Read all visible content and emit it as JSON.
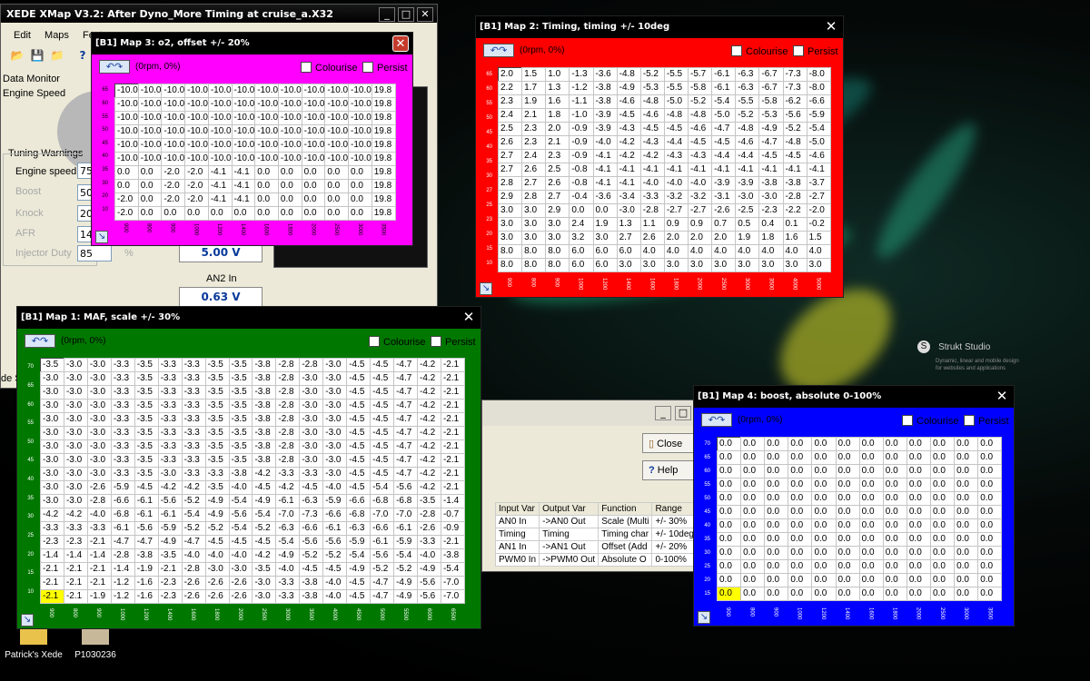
{
  "main_window": {
    "title": "XEDE XMap V3.2: After Dyno_More Timing at cruise_a.X32",
    "menu": [
      "Edit",
      "Maps",
      "Feat"
    ],
    "data_monitor": "Data Monitor",
    "engine_speed": "Engine Speed",
    "tuning_warnings": "Tuning Warnings",
    "warnings": [
      {
        "label": "Engine speed",
        "value": "750"
      },
      {
        "label": "Boost",
        "value": "50"
      },
      {
        "label": "Knock",
        "value": "20"
      },
      {
        "label": "AFR",
        "value": "14"
      },
      {
        "label": "Injector Duty",
        "value": "85",
        "unit": "%"
      }
    ],
    "volt1": "5.00 V",
    "an2_label": "AN2 In",
    "volt2": "0.63 V",
    "side_text": "de S"
  },
  "map3": {
    "title": "[B1] Map 3: o2, offset +/- 20%",
    "color": "#ff00ff",
    "rpm_label": "(0rpm, 0%)",
    "colourise": "Colourise",
    "persist": "Persist",
    "y_axis": [
      "65",
      "60",
      "55",
      "50",
      "45",
      "40",
      "35",
      "30",
      "20",
      "10"
    ],
    "x_axis": [
      "900",
      "800",
      "900",
      "1000",
      "1200",
      "1400",
      "1600",
      "1800",
      "2000",
      "2500",
      "3000",
      "3500"
    ],
    "rows": [
      [
        "-10.0",
        "-10.0",
        "-10.0",
        "-10.0",
        "-10.0",
        "-10.0",
        "-10.0",
        "-10.0",
        "-10.0",
        "-10.0",
        "-10.0",
        "19.8"
      ],
      [
        "-10.0",
        "-10.0",
        "-10.0",
        "-10.0",
        "-10.0",
        "-10.0",
        "-10.0",
        "-10.0",
        "-10.0",
        "-10.0",
        "-10.0",
        "19.8"
      ],
      [
        "-10.0",
        "-10.0",
        "-10.0",
        "-10.0",
        "-10.0",
        "-10.0",
        "-10.0",
        "-10.0",
        "-10.0",
        "-10.0",
        "-10.0",
        "19.8"
      ],
      [
        "-10.0",
        "-10.0",
        "-10.0",
        "-10.0",
        "-10.0",
        "-10.0",
        "-10.0",
        "-10.0",
        "-10.0",
        "-10.0",
        "-10.0",
        "19.8"
      ],
      [
        "-10.0",
        "-10.0",
        "-10.0",
        "-10.0",
        "-10.0",
        "-10.0",
        "-10.0",
        "-10.0",
        "-10.0",
        "-10.0",
        "-10.0",
        "19.8"
      ],
      [
        "-10.0",
        "-10.0",
        "-10.0",
        "-10.0",
        "-10.0",
        "-10.0",
        "-10.0",
        "-10.0",
        "-10.0",
        "-10.0",
        "-10.0",
        "19.8"
      ],
      [
        "0.0",
        "0.0",
        "-2.0",
        "-2.0",
        "-4.1",
        "-4.1",
        "0.0",
        "0.0",
        "0.0",
        "0.0",
        "0.0",
        "19.8"
      ],
      [
        "0.0",
        "0.0",
        "-2.0",
        "-2.0",
        "-4.1",
        "-4.1",
        "0.0",
        "0.0",
        "0.0",
        "0.0",
        "0.0",
        "19.8"
      ],
      [
        "-2.0",
        "0.0",
        "-2.0",
        "-2.0",
        "-4.1",
        "-4.1",
        "0.0",
        "0.0",
        "0.0",
        "0.0",
        "0.0",
        "19.8"
      ],
      [
        "-2.0",
        "0.0",
        "0.0",
        "0.0",
        "0.0",
        "0.0",
        "0.0",
        "0.0",
        "0.0",
        "0.0",
        "0.0",
        "19.8"
      ]
    ]
  },
  "map2": {
    "title": "[B1] Map 2: Timing, timing +/- 10deg",
    "color": "#ff0000",
    "rpm_label": "(0rpm, 0%)",
    "colourise": "Colourise",
    "persist": "Persist",
    "y_axis": [
      "65",
      "60",
      "55",
      "50",
      "45",
      "40",
      "35",
      "30",
      "27",
      "25",
      "23",
      "20",
      "15",
      "10"
    ],
    "x_axis": [
      "900",
      "800",
      "900",
      "1000",
      "1200",
      "1400",
      "1600",
      "1800",
      "2000",
      "2500",
      "3000",
      "3500",
      "4000",
      "5000"
    ],
    "rows": [
      [
        "2.0",
        "1.5",
        "1.0",
        "-1.3",
        "-3.6",
        "-4.8",
        "-5.2",
        "-5.5",
        "-5.7",
        "-6.1",
        "-6.3",
        "-6.7",
        "-7.3",
        "-8.0"
      ],
      [
        "2.2",
        "1.7",
        "1.3",
        "-1.2",
        "-3.8",
        "-4.9",
        "-5.3",
        "-5.5",
        "-5.8",
        "-6.1",
        "-6.3",
        "-6.7",
        "-7.3",
        "-8.0"
      ],
      [
        "2.3",
        "1.9",
        "1.6",
        "-1.1",
        "-3.8",
        "-4.6",
        "-4.8",
        "-5.0",
        "-5.2",
        "-5.4",
        "-5.5",
        "-5.8",
        "-6.2",
        "-6.6"
      ],
      [
        "2.4",
        "2.1",
        "1.8",
        "-1.0",
        "-3.9",
        "-4.5",
        "-4.6",
        "-4.8",
        "-4.8",
        "-5.0",
        "-5.2",
        "-5.3",
        "-5.6",
        "-5.9"
      ],
      [
        "2.5",
        "2.3",
        "2.0",
        "-0.9",
        "-3.9",
        "-4.3",
        "-4.5",
        "-4.5",
        "-4.6",
        "-4.7",
        "-4.8",
        "-4.9",
        "-5.2",
        "-5.4"
      ],
      [
        "2.6",
        "2.3",
        "2.1",
        "-0.9",
        "-4.0",
        "-4.2",
        "-4.3",
        "-4.4",
        "-4.5",
        "-4.5",
        "-4.6",
        "-4.7",
        "-4.8",
        "-5.0"
      ],
      [
        "2.7",
        "2.4",
        "2.3",
        "-0.9",
        "-4.1",
        "-4.2",
        "-4.2",
        "-4.3",
        "-4.3",
        "-4.4",
        "-4.4",
        "-4.5",
        "-4.5",
        "-4.6"
      ],
      [
        "2.7",
        "2.6",
        "2.5",
        "-0.8",
        "-4.1",
        "-4.1",
        "-4.1",
        "-4.1",
        "-4.1",
        "-4.1",
        "-4.1",
        "-4.1",
        "-4.1",
        "-4.1"
      ],
      [
        "2.8",
        "2.7",
        "2.6",
        "-0.8",
        "-4.1",
        "-4.1",
        "-4.0",
        "-4.0",
        "-4.0",
        "-3.9",
        "-3.9",
        "-3.8",
        "-3.8",
        "-3.7"
      ],
      [
        "2.9",
        "2.8",
        "2.7",
        "-0.4",
        "-3.6",
        "-3.4",
        "-3.3",
        "-3.2",
        "-3.2",
        "-3.1",
        "-3.0",
        "-3.0",
        "-2.8",
        "-2.7"
      ],
      [
        "3.0",
        "3.0",
        "2.9",
        "0.0",
        "0.0",
        "-3.0",
        "-2.8",
        "-2.7",
        "-2.7",
        "-2.6",
        "-2.5",
        "-2.3",
        "-2.2",
        "-2.0"
      ],
      [
        "3.0",
        "3.0",
        "3.0",
        "2.4",
        "1.9",
        "1.3",
        "1.1",
        "0.9",
        "0.9",
        "0.7",
        "0.5",
        "0.4",
        "0.1",
        "-0.2"
      ],
      [
        "3.0",
        "3.0",
        "3.0",
        "3.2",
        "3.0",
        "2.7",
        "2.6",
        "2.0",
        "2.0",
        "2.0",
        "1.9",
        "1.8",
        "1.6",
        "1.5"
      ],
      [
        "8.0",
        "8.0",
        "8.0",
        "6.0",
        "6.0",
        "6.0",
        "4.0",
        "4.0",
        "4.0",
        "4.0",
        "4.0",
        "4.0",
        "4.0",
        "4.0"
      ],
      [
        "8.0",
        "8.0",
        "8.0",
        "6.0",
        "6.0",
        "3.0",
        "3.0",
        "3.0",
        "3.0",
        "3.0",
        "3.0",
        "3.0",
        "3.0",
        "3.0"
      ]
    ]
  },
  "map1": {
    "title": "[B1] Map 1: MAF, scale +/- 30%",
    "color": "#007800",
    "rpm_label": "(0rpm, 0%)",
    "colourise": "Colourise",
    "persist": "Persist",
    "y_axis": [
      "70",
      "65",
      "60",
      "55",
      "50",
      "45",
      "40",
      "35",
      "30",
      "25",
      "20",
      "15",
      "10"
    ],
    "x_axis": [
      "900",
      "800",
      "900",
      "1000",
      "1200",
      "1400",
      "1600",
      "1800",
      "2000",
      "2500",
      "3000",
      "3500",
      "4000",
      "4500",
      "5000",
      "5500",
      "6000",
      "6500"
    ],
    "rows": [
      [
        "-3.5",
        "-3.0",
        "-3.0",
        "-3.3",
        "-3.5",
        "-3.3",
        "-3.3",
        "-3.5",
        "-3.5",
        "-3.8",
        "-2.8",
        "-2.8",
        "-3.0",
        "-4.5",
        "-4.5",
        "-4.7",
        "-4.2",
        "-2.1"
      ],
      [
        "-3.0",
        "-3.0",
        "-3.0",
        "-3.3",
        "-3.5",
        "-3.3",
        "-3.3",
        "-3.5",
        "-3.5",
        "-3.8",
        "-2.8",
        "-3.0",
        "-3.0",
        "-4.5",
        "-4.5",
        "-4.7",
        "-4.2",
        "-2.1"
      ],
      [
        "-3.0",
        "-3.0",
        "-3.0",
        "-3.3",
        "-3.5",
        "-3.3",
        "-3.3",
        "-3.5",
        "-3.5",
        "-3.8",
        "-2.8",
        "-3.0",
        "-3.0",
        "-4.5",
        "-4.5",
        "-4.7",
        "-4.2",
        "-2.1"
      ],
      [
        "-3.0",
        "-3.0",
        "-3.0",
        "-3.3",
        "-3.5",
        "-3.3",
        "-3.3",
        "-3.5",
        "-3.5",
        "-3.8",
        "-2.8",
        "-3.0",
        "-3.0",
        "-4.5",
        "-4.5",
        "-4.7",
        "-4.2",
        "-2.1"
      ],
      [
        "-3.0",
        "-3.0",
        "-3.0",
        "-3.3",
        "-3.5",
        "-3.3",
        "-3.3",
        "-3.5",
        "-3.5",
        "-3.8",
        "-2.8",
        "-3.0",
        "-3.0",
        "-4.5",
        "-4.5",
        "-4.7",
        "-4.2",
        "-2.1"
      ],
      [
        "-3.0",
        "-3.0",
        "-3.0",
        "-3.3",
        "-3.5",
        "-3.3",
        "-3.3",
        "-3.5",
        "-3.5",
        "-3.8",
        "-2.8",
        "-3.0",
        "-3.0",
        "-4.5",
        "-4.5",
        "-4.7",
        "-4.2",
        "-2.1"
      ],
      [
        "-3.0",
        "-3.0",
        "-3.0",
        "-3.3",
        "-3.5",
        "-3.3",
        "-3.3",
        "-3.5",
        "-3.5",
        "-3.8",
        "-2.8",
        "-3.0",
        "-3.0",
        "-4.5",
        "-4.5",
        "-4.7",
        "-4.2",
        "-2.1"
      ],
      [
        "-3.0",
        "-3.0",
        "-3.0",
        "-3.3",
        "-3.5",
        "-3.3",
        "-3.3",
        "-3.5",
        "-3.5",
        "-3.8",
        "-2.8",
        "-3.0",
        "-3.0",
        "-4.5",
        "-4.5",
        "-4.7",
        "-4.2",
        "-2.1"
      ],
      [
        "-3.0",
        "-3.0",
        "-3.0",
        "-3.3",
        "-3.5",
        "-3.0",
        "-3.3",
        "-3.3",
        "-3.8",
        "-4.2",
        "-3.3",
        "-3.3",
        "-3.0",
        "-4.5",
        "-4.5",
        "-4.7",
        "-4.2",
        "-2.1"
      ],
      [
        "-3.0",
        "-3.0",
        "-2.6",
        "-5.9",
        "-4.5",
        "-4.2",
        "-4.2",
        "-3.5",
        "-4.0",
        "-4.5",
        "-4.2",
        "-4.5",
        "-4.0",
        "-4.5",
        "-5.4",
        "-5.6",
        "-4.2",
        "-2.1"
      ],
      [
        "-3.0",
        "-3.0",
        "-2.8",
        "-6.6",
        "-6.1",
        "-5.6",
        "-5.2",
        "-4.9",
        "-5.4",
        "-4.9",
        "-6.1",
        "-6.3",
        "-5.9",
        "-6.6",
        "-6.8",
        "-6.8",
        "-3.5",
        "-1.4"
      ],
      [
        "-4.2",
        "-4.2",
        "-4.0",
        "-6.8",
        "-6.1",
        "-6.1",
        "-5.4",
        "-4.9",
        "-5.6",
        "-5.4",
        "-7.0",
        "-7.3",
        "-6.6",
        "-6.8",
        "-7.0",
        "-7.0",
        "-2.8",
        "-0.7"
      ],
      [
        "-3.3",
        "-3.3",
        "-3.3",
        "-6.1",
        "-5.6",
        "-5.9",
        "-5.2",
        "-5.2",
        "-5.4",
        "-5.2",
        "-6.3",
        "-6.6",
        "-6.1",
        "-6.3",
        "-6.6",
        "-6.1",
        "-2.6",
        "-0.9"
      ],
      [
        "-2.3",
        "-2.3",
        "-2.1",
        "-4.7",
        "-4.7",
        "-4.9",
        "-4.7",
        "-4.5",
        "-4.5",
        "-4.5",
        "-5.4",
        "-5.6",
        "-5.6",
        "-5.9",
        "-6.1",
        "-5.9",
        "-3.3",
        "-2.1"
      ],
      [
        "-1.4",
        "-1.4",
        "-1.4",
        "-2.8",
        "-3.8",
        "-3.5",
        "-4.0",
        "-4.0",
        "-4.0",
        "-4.2",
        "-4.9",
        "-5.2",
        "-5.2",
        "-5.4",
        "-5.6",
        "-5.4",
        "-4.0",
        "-3.8"
      ],
      [
        "-2.1",
        "-2.1",
        "-2.1",
        "-1.4",
        "-1.9",
        "-2.1",
        "-2.8",
        "-3.0",
        "-3.0",
        "-3.5",
        "-4.0",
        "-4.5",
        "-4.5",
        "-4.9",
        "-5.2",
        "-5.2",
        "-4.9",
        "-5.4"
      ],
      [
        "-2.1",
        "-2.1",
        "-2.1",
        "-1.2",
        "-1.6",
        "-2.3",
        "-2.6",
        "-2.6",
        "-2.6",
        "-3.0",
        "-3.3",
        "-3.8",
        "-4.0",
        "-4.5",
        "-4.7",
        "-4.9",
        "-5.6",
        "-7.0"
      ],
      [
        "-2.1",
        "-2.1",
        "-1.9",
        "-1.2",
        "-1.6",
        "-2.3",
        "-2.6",
        "-2.6",
        "-2.6",
        "-3.0",
        "-3.3",
        "-3.8",
        "-4.0",
        "-4.5",
        "-4.7",
        "-4.9",
        "-5.6",
        "-7.0"
      ]
    ]
  },
  "map4": {
    "title": "[B1] Map 4: boost, absolute 0-100%",
    "color": "#0000ff",
    "rpm_label": "(0rpm, 0%)",
    "colourise": "Colourise",
    "persist": "Persist",
    "y_axis": [
      "70",
      "65",
      "60",
      "55",
      "50",
      "45",
      "40",
      "35",
      "30",
      "25",
      "20",
      "15"
    ],
    "x_axis": [
      "900",
      "800",
      "900",
      "1000",
      "1200",
      "1400",
      "1600",
      "1800",
      "2000",
      "2500",
      "3000",
      "3500"
    ],
    "rows": [
      [
        "0.0",
        "0.0",
        "0.0",
        "0.0",
        "0.0",
        "0.0",
        "0.0",
        "0.0",
        "0.0",
        "0.0",
        "0.0",
        "0.0"
      ],
      [
        "0.0",
        "0.0",
        "0.0",
        "0.0",
        "0.0",
        "0.0",
        "0.0",
        "0.0",
        "0.0",
        "0.0",
        "0.0",
        "0.0"
      ],
      [
        "0.0",
        "0.0",
        "0.0",
        "0.0",
        "0.0",
        "0.0",
        "0.0",
        "0.0",
        "0.0",
        "0.0",
        "0.0",
        "0.0"
      ],
      [
        "0.0",
        "0.0",
        "0.0",
        "0.0",
        "0.0",
        "0.0",
        "0.0",
        "0.0",
        "0.0",
        "0.0",
        "0.0",
        "0.0"
      ],
      [
        "0.0",
        "0.0",
        "0.0",
        "0.0",
        "0.0",
        "0.0",
        "0.0",
        "0.0",
        "0.0",
        "0.0",
        "0.0",
        "0.0"
      ],
      [
        "0.0",
        "0.0",
        "0.0",
        "0.0",
        "0.0",
        "0.0",
        "0.0",
        "0.0",
        "0.0",
        "0.0",
        "0.0",
        "0.0"
      ],
      [
        "0.0",
        "0.0",
        "0.0",
        "0.0",
        "0.0",
        "0.0",
        "0.0",
        "0.0",
        "0.0",
        "0.0",
        "0.0",
        "0.0"
      ],
      [
        "0.0",
        "0.0",
        "0.0",
        "0.0",
        "0.0",
        "0.0",
        "0.0",
        "0.0",
        "0.0",
        "0.0",
        "0.0",
        "0.0"
      ],
      [
        "0.0",
        "0.0",
        "0.0",
        "0.0",
        "0.0",
        "0.0",
        "0.0",
        "0.0",
        "0.0",
        "0.0",
        "0.0",
        "0.0"
      ],
      [
        "0.0",
        "0.0",
        "0.0",
        "0.0",
        "0.0",
        "0.0",
        "0.0",
        "0.0",
        "0.0",
        "0.0",
        "0.0",
        "0.0"
      ],
      [
        "0.0",
        "0.0",
        "0.0",
        "0.0",
        "0.0",
        "0.0",
        "0.0",
        "0.0",
        "0.0",
        "0.0",
        "0.0",
        "0.0"
      ],
      [
        "0.0",
        "0.0",
        "0.0",
        "0.0",
        "0.0",
        "0.0",
        "0.0",
        "0.0",
        "0.0",
        "0.0",
        "0.0",
        "0.0"
      ]
    ]
  },
  "io_window": {
    "close": "Close",
    "help": "Help",
    "headers": [
      "Input Var",
      "Output Var",
      "Function",
      "Range"
    ],
    "rows": [
      [
        "AN0 In",
        "->AN0 Out",
        "Scale (Multi",
        "+/- 30%"
      ],
      [
        "Timing",
        "Timing",
        "Timing char",
        "+/- 10deg"
      ],
      [
        "AN1 In",
        "->AN1 Out",
        "Offset (Add",
        "+/- 20%"
      ],
      [
        "PWM0 In",
        "->PWM0 Out",
        "Absolute O",
        "0-100%"
      ]
    ]
  },
  "desktop": {
    "icon1": "Patrick's Xede",
    "icon2": "P1030236",
    "strukt_title": "Strukt Studio",
    "strukt_sub1": "Dynamic, linear and mobile design",
    "strukt_sub2": "for websites and applications"
  }
}
